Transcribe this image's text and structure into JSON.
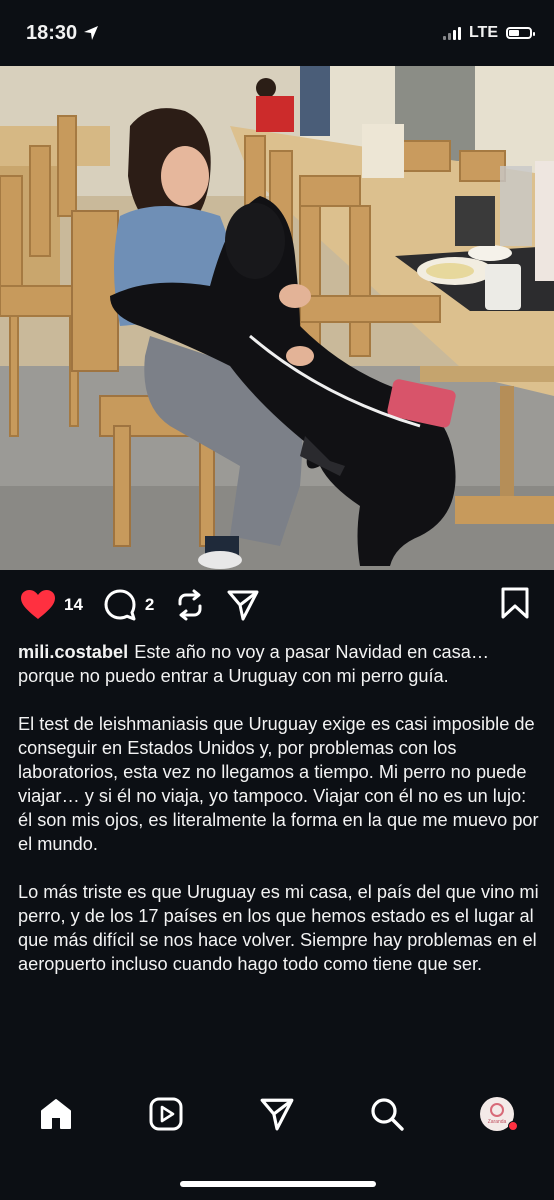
{
  "status_bar": {
    "time": "18:30",
    "network": "LTE",
    "location_icon": "location-arrow-icon",
    "signal_icon": "signal-bars-icon",
    "battery_icon": "battery-icon",
    "battery_level": 0.5
  },
  "post": {
    "photo_alt": "woman hugging black guide dog",
    "actions": {
      "like_icon": "heart-filled-icon",
      "likes": "14",
      "comment_icon": "comment-bubble-icon",
      "comments": "2",
      "repost_icon": "repost-icon",
      "share_icon": "send-icon",
      "save_icon": "bookmark-icon"
    },
    "username": "mili.costabel",
    "caption_paragraphs": [
      "Este año no voy a pasar Navidad en casa… porque no puedo entrar a Uruguay con mi perro guía.",
      "El test de leishmaniasis que Uruguay exige es casi imposible de conseguir en Estados Unidos y, por problemas con los laboratorios, esta vez no llegamos a tiempo. Mi perro no puede viajar… y si él no viaja, yo tampoco. Viajar con él no es un lujo: él son mis ojos, es literalmente la forma en la que me muevo por el mundo.",
      "Lo más triste es que Uruguay es mi casa, el país del que vino mi perro, y de los 17 países en los que hemos estado es el lugar al que más difícil se nos hace volver. Siempre hay problemas en el aeropuerto incluso cuando hago todo como tiene que ser."
    ]
  },
  "bottom_nav": {
    "items": [
      {
        "icon": "home-icon"
      },
      {
        "icon": "reels-icon"
      },
      {
        "icon": "send-icon"
      },
      {
        "icon": "search-icon"
      },
      {
        "icon": "profile-avatar",
        "avatar_text": "Zaranda"
      }
    ]
  },
  "colors": {
    "background": "#0c0f14",
    "like_red": "#ff3040",
    "text": "#f2f2f2"
  }
}
